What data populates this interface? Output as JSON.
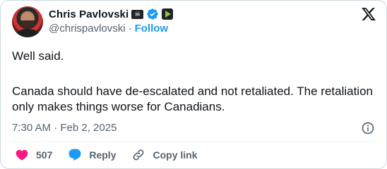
{
  "author": {
    "name": "Chris Pavlovski",
    "handle": "@chrispavlovski",
    "separator": "·",
    "follow_label": "Follow",
    "badges": [
      "flag-badge-icon",
      "verified-icon",
      "rumble-icon"
    ]
  },
  "tweet": {
    "line1": "Well said.",
    "line2": "Canada should have de-escalated and not retaliated. The retaliation only makes things worse for Canadians.",
    "timestamp": "7:30 AM · Feb 2, 2025"
  },
  "actions": {
    "likes_count": "507",
    "reply_label": "Reply",
    "copy_label": "Copy link"
  },
  "colors": {
    "accent": "#1d9bf0",
    "like": "#f91880",
    "text": "#0f1419",
    "muted": "#536471"
  }
}
